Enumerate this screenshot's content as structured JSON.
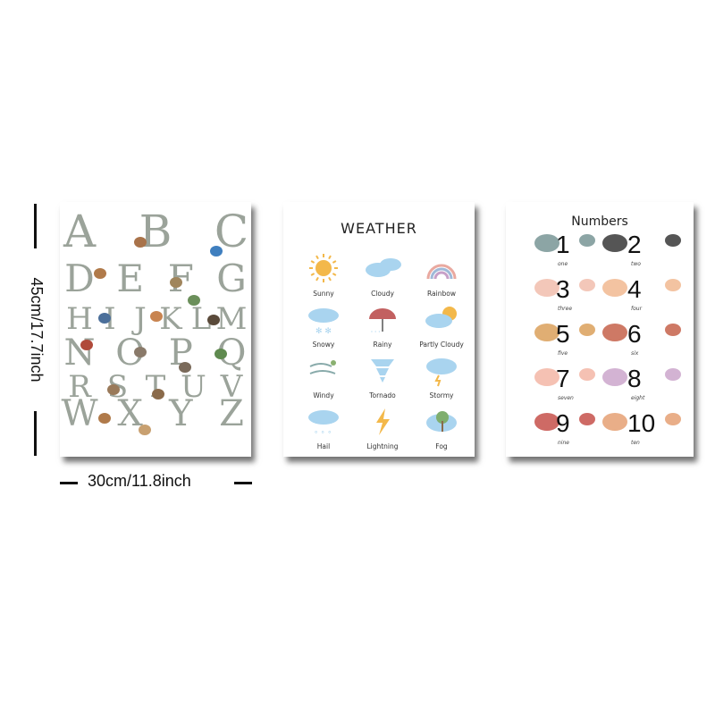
{
  "dimensions": {
    "height_label": "45cm/17.7inch",
    "width_label": "30cm/11.8inch"
  },
  "weather_poster": {
    "title": "WEATHER",
    "items": [
      {
        "label": "Sunny",
        "icon": "sun-icon"
      },
      {
        "label": "Cloudy",
        "icon": "clouds-icon"
      },
      {
        "label": "Rainbow",
        "icon": "rainbow-icon"
      },
      {
        "label": "Snowy",
        "icon": "snow-cloud-icon"
      },
      {
        "label": "Rainy",
        "icon": "umbrella-icon"
      },
      {
        "label": "Partly Cloudy",
        "icon": "sun-behind-cloud-icon"
      },
      {
        "label": "Windy",
        "icon": "wind-icon"
      },
      {
        "label": "Tornado",
        "icon": "tornado-icon"
      },
      {
        "label": "Stormy",
        "icon": "storm-cloud-icon"
      },
      {
        "label": "Hail",
        "icon": "hail-cloud-icon"
      },
      {
        "label": "Lightning",
        "icon": "lightning-icon"
      },
      {
        "label": "Fog",
        "icon": "fog-tree-icon"
      }
    ]
  },
  "numbers_poster": {
    "title": "Numbers",
    "items": [
      {
        "digit": "1",
        "word": "one"
      },
      {
        "digit": "2",
        "word": "two"
      },
      {
        "digit": "3",
        "word": "three"
      },
      {
        "digit": "4",
        "word": "four"
      },
      {
        "digit": "5",
        "word": "five"
      },
      {
        "digit": "6",
        "word": "six"
      },
      {
        "digit": "7",
        "word": "seven"
      },
      {
        "digit": "8",
        "word": "eight"
      },
      {
        "digit": "9",
        "word": "nine"
      },
      {
        "digit": "10",
        "word": "ten"
      }
    ]
  },
  "alphabet_poster": {
    "letters": [
      "A",
      "B",
      "C",
      "D",
      "E",
      "F",
      "G",
      "H",
      "I",
      "J",
      "K",
      "L",
      "M",
      "N",
      "O",
      "P",
      "Q",
      "R",
      "S",
      "T",
      "U",
      "V",
      "W",
      "X",
      "Y",
      "Z"
    ]
  },
  "colors": {
    "letter_gray": "#8a9388",
    "sky_blue": "#a9d4ef",
    "sun_yellow": "#f3b84a",
    "shadow": "#2b2b2b"
  }
}
